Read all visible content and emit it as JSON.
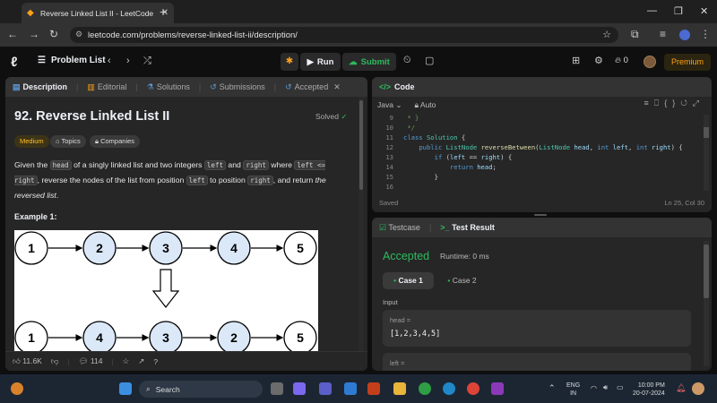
{
  "browser": {
    "tab_title": "Reverse Linked List II - LeetCode",
    "url": "leetcode.com/problems/reverse-linked-list-ii/description/"
  },
  "nav": {
    "problem_list": "Problem List",
    "run": "Run",
    "submit": "Submit",
    "streak": "0",
    "premium": "Premium"
  },
  "left_tabs": {
    "description": "Description",
    "editorial": "Editorial",
    "solutions": "Solutions",
    "submissions": "Submissions",
    "accepted": "Accepted"
  },
  "problem": {
    "title": "92. Reverse Linked List II",
    "status": "Solved",
    "difficulty": "Medium",
    "topics": "Topics",
    "companies": "Companies",
    "desc_1": "Given the ",
    "head": "head",
    "desc_2": " of a singly linked list and two integers ",
    "left": "left",
    "desc_3": " and ",
    "right": "right",
    "desc_4": " where ",
    "cond": "left <= right",
    "desc_5": ", reverse the nodes of the list from position ",
    "desc_6": " to position ",
    "desc_7": ", and return ",
    "desc_em": "the reversed list",
    "desc_8": ".",
    "example_label": "Example 1:",
    "list_before": [
      "1",
      "2",
      "3",
      "4",
      "5"
    ],
    "list_after": [
      "1",
      "4",
      "3",
      "2",
      "5"
    ]
  },
  "footer_left": {
    "likes": "11.6K",
    "comments": "114"
  },
  "code_panel": {
    "title": "Code",
    "language": "Java",
    "mode": "Auto",
    "lines": [
      {
        "n": "9",
        "t": " * }"
      },
      {
        "n": "10",
        "t": " */"
      },
      {
        "n": "11",
        "t": "class Solution {"
      },
      {
        "n": "12",
        "t": "    public ListNode reverseBetween(ListNode head, int left, int right) {"
      },
      {
        "n": "13",
        "t": "        if (left == right) {"
      },
      {
        "n": "14",
        "t": "            return head;"
      },
      {
        "n": "15",
        "t": "        }"
      },
      {
        "n": "16",
        "t": ""
      }
    ],
    "saved": "Saved",
    "cursor": "Ln 25, Col 30"
  },
  "result_panel": {
    "testcase_tab": "Testcase",
    "result_tab": "Test Result",
    "status": "Accepted",
    "runtime": "Runtime: 0 ms",
    "case1": "Case 1",
    "case2": "Case 2",
    "input_label": "Input",
    "head_label": "head =",
    "head_value": "[1,2,3,4,5]",
    "left_label": "left ="
  },
  "taskbar": {
    "search": "Search",
    "lang_1": "ENG",
    "lang_2": "IN",
    "time": "10:00 PM",
    "date": "20-07-2024"
  },
  "colors": {
    "accent": "#ffa116",
    "success": "#2cbb5d",
    "panel": "#262626",
    "node_highlight": "#dbe8f8"
  }
}
